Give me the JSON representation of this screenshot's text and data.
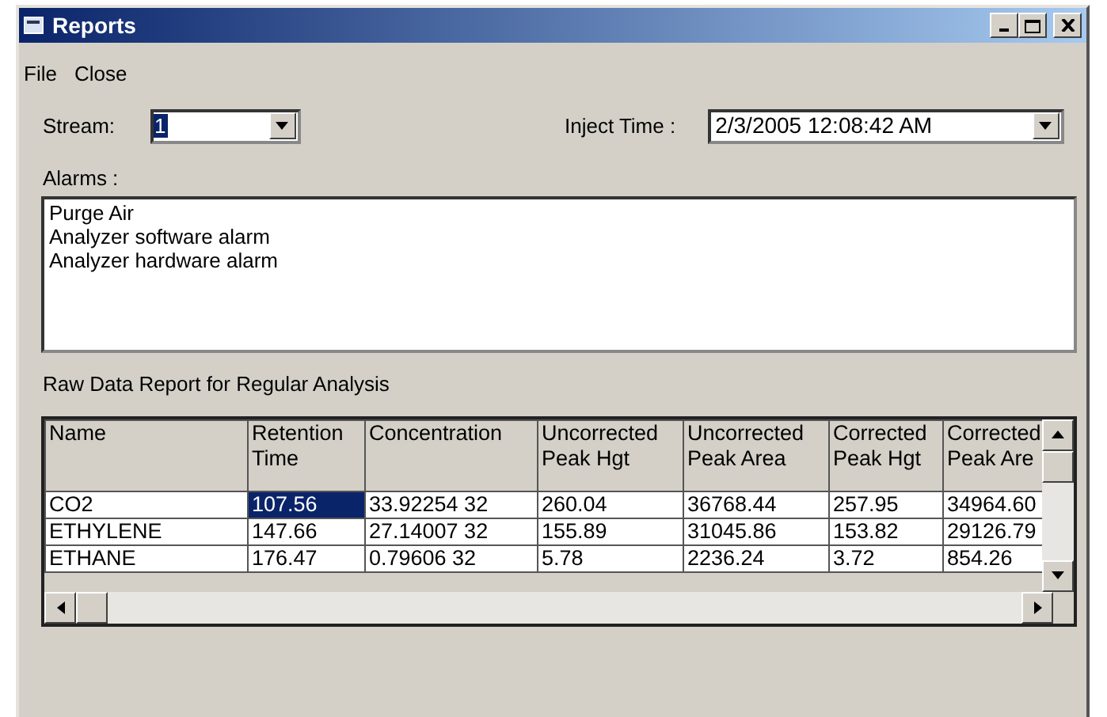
{
  "window": {
    "title": "Reports"
  },
  "menu": [
    "File",
    "Close"
  ],
  "stream": {
    "label": "Stream:",
    "value": "1",
    "value_selected": true
  },
  "inject_time": {
    "label": "Inject Time :",
    "value": "2/3/2005 12:08:42 AM"
  },
  "alarms": {
    "label": "Alarms :",
    "items": [
      "Purge Air",
      "Analyzer software alarm",
      "Analyzer hardware alarm"
    ]
  },
  "report": {
    "title": "Raw Data Report for Regular Analysis",
    "columns": [
      {
        "lines": [
          "Name"
        ]
      },
      {
        "lines": [
          "Retention",
          "Time"
        ]
      },
      {
        "lines": [
          "Concentration"
        ]
      },
      {
        "lines": [
          "Uncorrected",
          "Peak Hgt"
        ]
      },
      {
        "lines": [
          "Uncorrected",
          "Peak Area"
        ]
      },
      {
        "lines": [
          "Corrected",
          "Peak Hgt"
        ]
      },
      {
        "lines": [
          "Corrected",
          "Peak Are"
        ]
      }
    ],
    "rows": [
      {
        "cells": [
          {
            "text": "CO2",
            "selected": false
          },
          {
            "text": "107.56",
            "selected": true
          },
          {
            "text": "33.92254 32",
            "selected": false
          },
          {
            "text": "260.04",
            "selected": false
          },
          {
            "text": "36768.44",
            "selected": false
          },
          {
            "text": "257.95",
            "selected": false
          },
          {
            "text": "34964.60",
            "selected": false
          }
        ]
      },
      {
        "cells": [
          {
            "text": "ETHYLENE",
            "selected": false
          },
          {
            "text": "147.66",
            "selected": false
          },
          {
            "text": "27.14007 32",
            "selected": false
          },
          {
            "text": "155.89",
            "selected": false
          },
          {
            "text": "31045.86",
            "selected": false
          },
          {
            "text": "153.82",
            "selected": false
          },
          {
            "text": "29126.79",
            "selected": false
          }
        ]
      },
      {
        "cells": [
          {
            "text": "ETHANE",
            "selected": false
          },
          {
            "text": "176.47",
            "selected": false
          },
          {
            "text": "0.79606 32",
            "selected": false
          },
          {
            "text": "5.78",
            "selected": false
          },
          {
            "text": "2236.24",
            "selected": false
          },
          {
            "text": "3.72",
            "selected": false
          },
          {
            "text": "854.26",
            "selected": false
          }
        ]
      }
    ]
  }
}
